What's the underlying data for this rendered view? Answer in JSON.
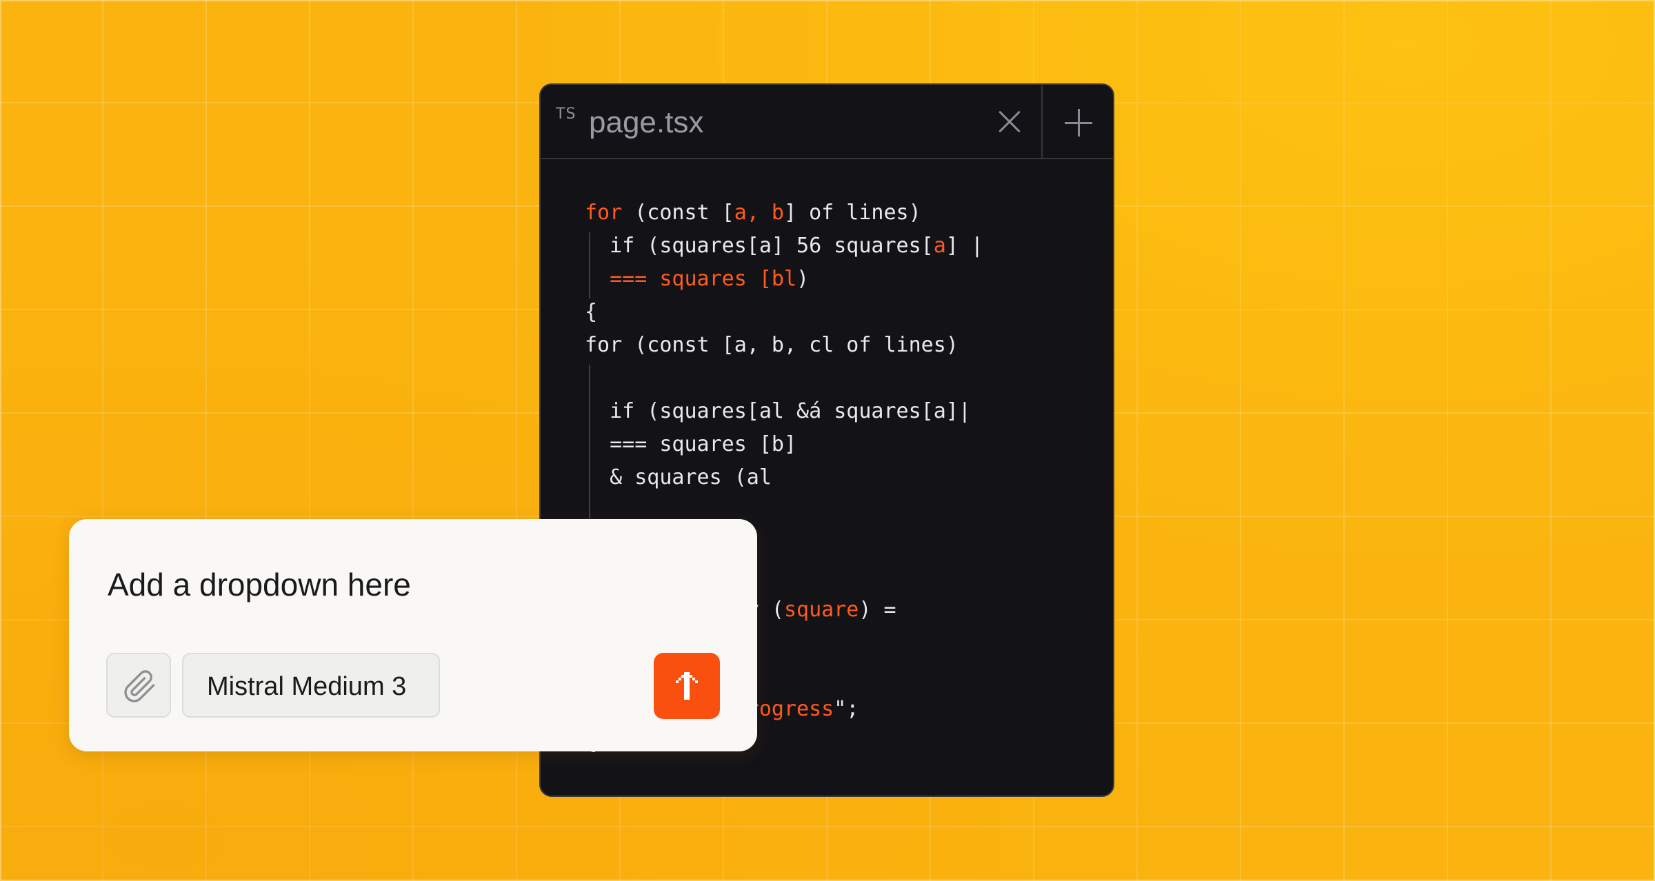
{
  "editor": {
    "tab": {
      "lang_badge": "TS",
      "file_name": "page.tsx"
    },
    "code_lines": [
      {
        "parts": [
          {
            "t": "for",
            "hl": true
          },
          {
            "t": " (const [",
            "hl": false
          },
          {
            "t": "a, b",
            "hl": true
          },
          {
            "t": "] of lines)",
            "hl": false
          }
        ]
      },
      {
        "parts": [
          {
            "t": "  if (squares[a] 56 squares[",
            "hl": false
          },
          {
            "t": "a",
            "hl": true
          },
          {
            "t": "] |",
            "hl": false
          }
        ]
      },
      {
        "parts": [
          {
            "t": "  === squares [bl",
            "hl": true
          },
          {
            "t": ")",
            "hl": false
          }
        ]
      },
      {
        "parts": [
          {
            "t": "{",
            "hl": false
          }
        ]
      },
      {
        "parts": [
          {
            "t": "for (const [a, b, cl of lines)",
            "hl": false
          }
        ]
      },
      {
        "parts": [
          {
            "t": "",
            "hl": false
          }
        ]
      },
      {
        "parts": [
          {
            "t": "  if (squares[al &á squares[a]|",
            "hl": false
          }
        ]
      },
      {
        "parts": [
          {
            "t": "  === squares [b]",
            "hl": false
          }
        ]
      },
      {
        "parts": [
          {
            "t": "  & squares (al",
            "hl": false
          }
        ]
      },
      {
        "parts": [
          {
            "t": "",
            "hl": false
          }
        ]
      },
      {
        "parts": [
          {
            "t": "",
            "hl": false
          }
        ]
      },
      {
        "parts": [
          {
            "t": "",
            "hl": false
          }
        ]
      },
      {
        "parts": [
          {
            "t": "            ry (",
            "hl": false
          },
          {
            "t": "square",
            "hl": true
          },
          {
            "t": ") =",
            "hl": false
          }
        ]
      },
      {
        "parts": [
          {
            "t": "            {",
            "hl": false
          }
        ]
      },
      {
        "parts": [
          {
            "t": "",
            "hl": false
          }
        ]
      },
      {
        "parts": [
          {
            "t": "            ",
            "hl": false
          },
          {
            "t": "Progress",
            "hl": true
          },
          {
            "t": "\";",
            "hl": false
          }
        ]
      },
      {
        "parts": [
          {
            "t": "{",
            "hl": false
          }
        ]
      }
    ]
  },
  "prompt": {
    "text": "Add a dropdown here",
    "model_label": "Mistral Medium 3",
    "attach_icon": "paperclip-icon",
    "send_icon": "arrow-up-icon"
  },
  "colors": {
    "background": "#fbb40f",
    "editor_bg": "#131317",
    "accent": "#fa500f",
    "card_bg": "#f9f8f6"
  }
}
